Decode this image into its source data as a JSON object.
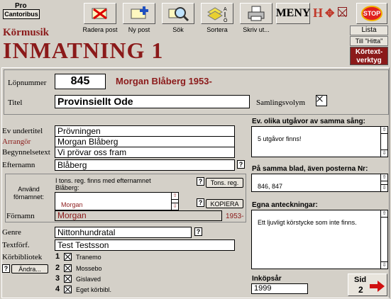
{
  "header": {
    "logo_top": "Pro",
    "logo_brand": "Cantoribus",
    "section": "Körmusik",
    "title": "INMATNING 1"
  },
  "toolbar": {
    "radera": "Radera post",
    "ny": "Ny post",
    "sok": "Sök",
    "sortera": "Sortera",
    "skriv": "Skriv ut...",
    "meny": "MENY",
    "stop": "STOP"
  },
  "side": {
    "lista": "Lista",
    "till_hitta": "Till \"Hitta\"",
    "kortext": "Körtext-\nverktyg"
  },
  "record": {
    "lopnummer_label": "Löpnummer",
    "lopnummer": "845",
    "composer": "Morgan Blåberg 1953-",
    "titel_label": "Titel",
    "titel": "Provinsiellt Ode",
    "samlingsvolym_label": "Samlingsvolym"
  },
  "fields": {
    "ev_undertitel_label": "Ev undertitel",
    "ev_undertitel": "Prövningen",
    "arrangor_label": "Arrangör",
    "arrangor": "Morgan Blåberg",
    "begynnelsetext_label": "Begynnelsetext",
    "begynnelsetext": "Vi prövar oss fram",
    "efternamn_label": "Efternamn",
    "efternamn": "Blåberg"
  },
  "fornamn_box": {
    "anvand_label": "Använd\nförnamnet:",
    "info": "I tons. reg. finns med efternamnet\nBlåberg:",
    "list_value": "Morgan",
    "tons_reg_button": "Tons. reg.",
    "kopiera_button": "KOPIERA",
    "fornamn_label": "Förnamn",
    "fornamn": "Morgan",
    "fornamn_year": "1953-"
  },
  "lower": {
    "genre_label": "Genre",
    "genre": "Nittonhundratal",
    "textforf_label": "Textförf.",
    "textforf": "Test Testsson",
    "korbibliotek_label": "Körbibliotek",
    "andra_button": "Ändra...",
    "libraries": [
      {
        "num": "1",
        "name": "Tranemo"
      },
      {
        "num": "2",
        "name": "Mossebo"
      },
      {
        "num": "3",
        "name": "Gislaved"
      },
      {
        "num": "4",
        "name": "Eget körbibl."
      }
    ]
  },
  "right": {
    "utgavor_label": "Ev. olika utgåvor av samma sång:",
    "utgavor": "5 utgåvor finns!",
    "samma_blad_label": "På samma blad, även posterna Nr:",
    "samma_blad": "846, 847",
    "anteckningar_label": "Egna anteckningar:",
    "anteckningar": "Ett ljuvligt körstycke som inte finns.",
    "inkopsar_label": "Inköpsår",
    "inkopsar": "1999",
    "sid_label": "Sid",
    "sid_num": "2"
  },
  "colors": {
    "accent": "#8b1a1a",
    "background": "#d4d0c8"
  }
}
